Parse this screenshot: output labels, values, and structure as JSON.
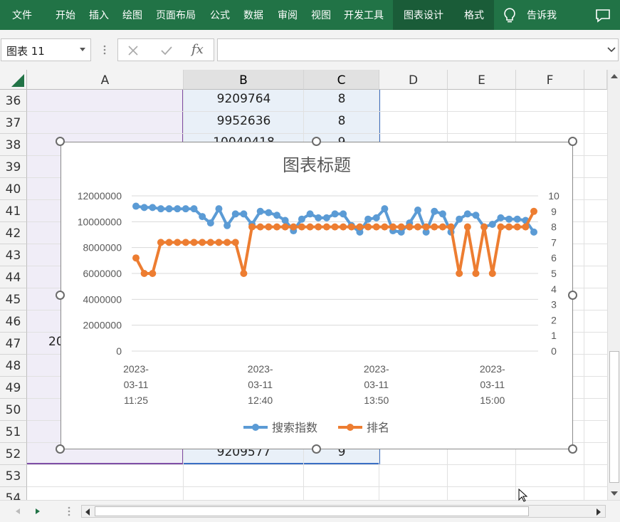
{
  "ribbon": {
    "tabs": [
      "文件",
      "开始",
      "插入",
      "绘图",
      "页面布局",
      "公式",
      "数据",
      "审阅",
      "视图",
      "开发工具",
      "图表设计",
      "格式"
    ],
    "tell_me": "告诉我"
  },
  "formula_bar": {
    "name_box": "图表 11",
    "fx_label": "fx",
    "formula": ""
  },
  "sheet": {
    "columns": [
      "A",
      "B",
      "C",
      "D",
      "E",
      "F"
    ],
    "rows": [
      "36",
      "37",
      "38",
      "39",
      "40",
      "41",
      "42",
      "43",
      "44",
      "45",
      "46",
      "47",
      "48",
      "49",
      "50",
      "51",
      "52",
      "53",
      "54"
    ],
    "visible_cells": {
      "b36": "9209764",
      "c36": "8",
      "b37": "9952636",
      "c37": "8",
      "b38": "10040418",
      "c38": "9",
      "a47": "20",
      "b52": "9209577",
      "c52": "9"
    }
  },
  "chart_data": {
    "type": "line",
    "title": "图表标题",
    "x_tick_labels": [
      [
        "2023-",
        "03-11",
        "11:25"
      ],
      [
        "2023-",
        "03-11",
        "12:40"
      ],
      [
        "2023-",
        "03-11",
        "13:50"
      ],
      [
        "2023-",
        "03-11",
        "15:00"
      ]
    ],
    "x_tick_indices": [
      0,
      15,
      29,
      43
    ],
    "y_left": {
      "min": 0,
      "max": 12000000,
      "ticks": [
        "0",
        "2000000",
        "4000000",
        "6000000",
        "8000000",
        "10000000",
        "12000000"
      ]
    },
    "y_right": {
      "min": 0,
      "max": 10,
      "ticks": [
        "0",
        "1",
        "2",
        "3",
        "4",
        "5",
        "6",
        "7",
        "8",
        "9",
        "10"
      ]
    },
    "grid": true,
    "legend": "bottom",
    "series": [
      {
        "name": "搜索指数",
        "axis": "left",
        "color": "#5b9bd5",
        "values": [
          11200000,
          11100000,
          11100000,
          11000000,
          11000000,
          11000000,
          11000000,
          11000000,
          10400000,
          9900000,
          11000000,
          9700000,
          10600000,
          10600000,
          9800000,
          10800000,
          10700000,
          10500000,
          10100000,
          9300000,
          10200000,
          10600000,
          10300000,
          10300000,
          10600000,
          10600000,
          9700000,
          9200000,
          10200000,
          10300000,
          11000000,
          9300000,
          9200000,
          9900000,
          10900000,
          9200000,
          10800000,
          10600000,
          9200000,
          10200000,
          10600000,
          10500000,
          9600000,
          9800000,
          10300000,
          10200000,
          10200000,
          10100000,
          9200000
        ]
      },
      {
        "name": "排名",
        "axis": "right",
        "color": "#ed7d31",
        "values": [
          6,
          5,
          5,
          7,
          7,
          7,
          7,
          7,
          7,
          7,
          7,
          7,
          7,
          5,
          8,
          8,
          8,
          8,
          8,
          8,
          8,
          8,
          8,
          8,
          8,
          8,
          8,
          8,
          8,
          8,
          8,
          8,
          8,
          8,
          8,
          8,
          8,
          8,
          8,
          5,
          8,
          5,
          8,
          5,
          8,
          8,
          8,
          8,
          9
        ]
      }
    ]
  }
}
